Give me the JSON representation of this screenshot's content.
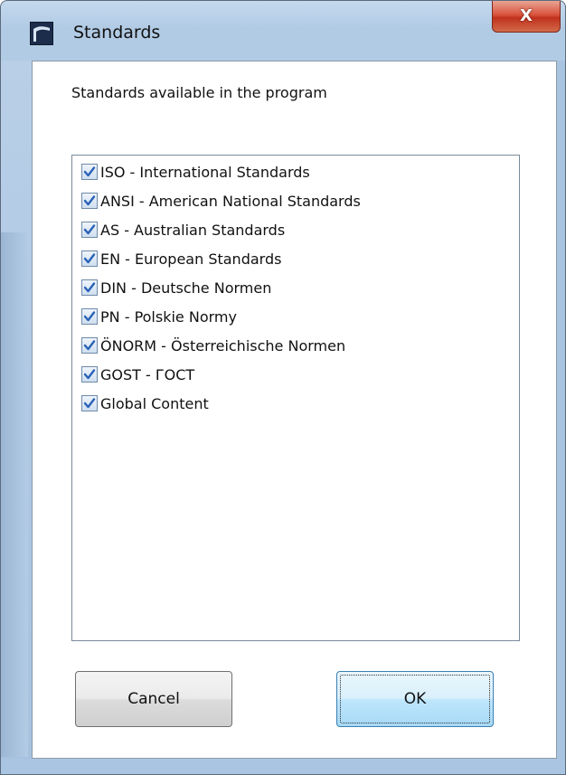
{
  "window": {
    "title": "Standards",
    "close_glyph": "X"
  },
  "dialog": {
    "heading": "Standards available in the program",
    "items": [
      {
        "label": "ISO - International Standards",
        "checked": true
      },
      {
        "label": "ANSI - American National Standards",
        "checked": true
      },
      {
        "label": "AS - Australian Standards",
        "checked": true
      },
      {
        "label": "EN - European Standards",
        "checked": true
      },
      {
        "label": "DIN - Deutsche Normen",
        "checked": true
      },
      {
        "label": "PN - Polskie Normy",
        "checked": true
      },
      {
        "label": "ÖNORM - Österreichische Normen",
        "checked": true
      },
      {
        "label": "GOST - ГОСТ",
        "checked": true
      },
      {
        "label": "Global Content",
        "checked": true
      }
    ]
  },
  "buttons": {
    "cancel_label": "Cancel",
    "ok_label": "OK"
  },
  "colors": {
    "check_mark": "#2a62b8",
    "frame": "#aac5e2",
    "close_button": "#c9402b"
  },
  "icons": {
    "app": "app-icon",
    "close": "close-icon",
    "check": "checkmark-icon"
  }
}
